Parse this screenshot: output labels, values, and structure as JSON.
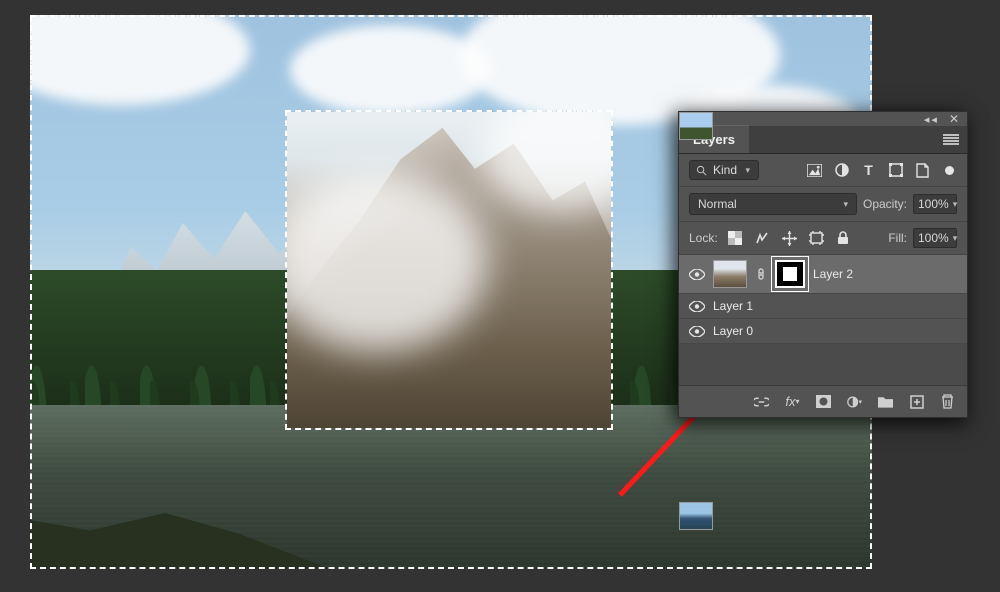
{
  "panel": {
    "title": "Layers",
    "filter": {
      "label": "Kind",
      "search_icon": "search"
    },
    "filter_icons": [
      "image-icon",
      "adjust-icon",
      "type-icon",
      "shape-icon",
      "smart-icon",
      "dot-icon"
    ],
    "blend_mode": "Normal",
    "opacity_label": "Opacity:",
    "opacity_value": "100%",
    "lock_label": "Lock:",
    "fill_label": "Fill:",
    "fill_value": "100%",
    "layers": [
      {
        "name": "Layer 2",
        "has_mask": true,
        "selected": true,
        "thumb": "mtn"
      },
      {
        "name": "Layer 1",
        "has_mask": false,
        "selected": false,
        "thumb": "sky"
      },
      {
        "name": "Layer 0",
        "has_mask": false,
        "selected": false,
        "thumb": "lake"
      }
    ],
    "footer_icons": [
      "link",
      "fx",
      "mask",
      "adjustment",
      "group",
      "new",
      "trash"
    ]
  }
}
